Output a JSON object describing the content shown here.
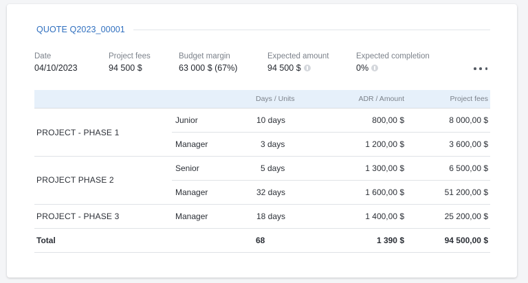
{
  "quote": {
    "title": "QUOTE Q2023_00001"
  },
  "summary": [
    {
      "label": "Date",
      "value": "04/10/2023",
      "info": false
    },
    {
      "label": "Project fees",
      "value": "94 500 $",
      "info": false
    },
    {
      "label": "Budget margin",
      "value": "63 000 $ (67%)",
      "info": false
    },
    {
      "label": "Expected amount",
      "value": "94 500 $",
      "info": true
    },
    {
      "label": "Expected completion",
      "value": "0%",
      "info": true
    }
  ],
  "table": {
    "headers": {
      "units": "Days / Units",
      "adr": "ADR / Amount",
      "fees": "Project fees"
    },
    "groups": [
      {
        "name": "PROJECT - PHASE 1",
        "rows": [
          {
            "role": "Junior",
            "units": "10  days",
            "adr": "800,00 $",
            "fees": "8 000,00 $"
          },
          {
            "role": "Manager",
            "units": "3  days",
            "adr": "1 200,00 $",
            "fees": "3 600,00 $"
          }
        ]
      },
      {
        "name": "PROJECT PHASE 2",
        "rows": [
          {
            "role": "Senior",
            "units": "5  days",
            "adr": "1 300,00 $",
            "fees": "6 500,00 $"
          },
          {
            "role": "Manager",
            "units": "32  days",
            "adr": "1 600,00 $",
            "fees": "51 200,00 $"
          }
        ]
      },
      {
        "name": "PROJECT - PHASE 3",
        "rows": [
          {
            "role": "Manager",
            "units": "18  days",
            "adr": "1 400,00 $",
            "fees": "25 200,00 $"
          }
        ]
      }
    ],
    "total": {
      "label": "Total",
      "units": "68",
      "adr": "1 390 $",
      "fees": "94 500,00 $"
    }
  }
}
